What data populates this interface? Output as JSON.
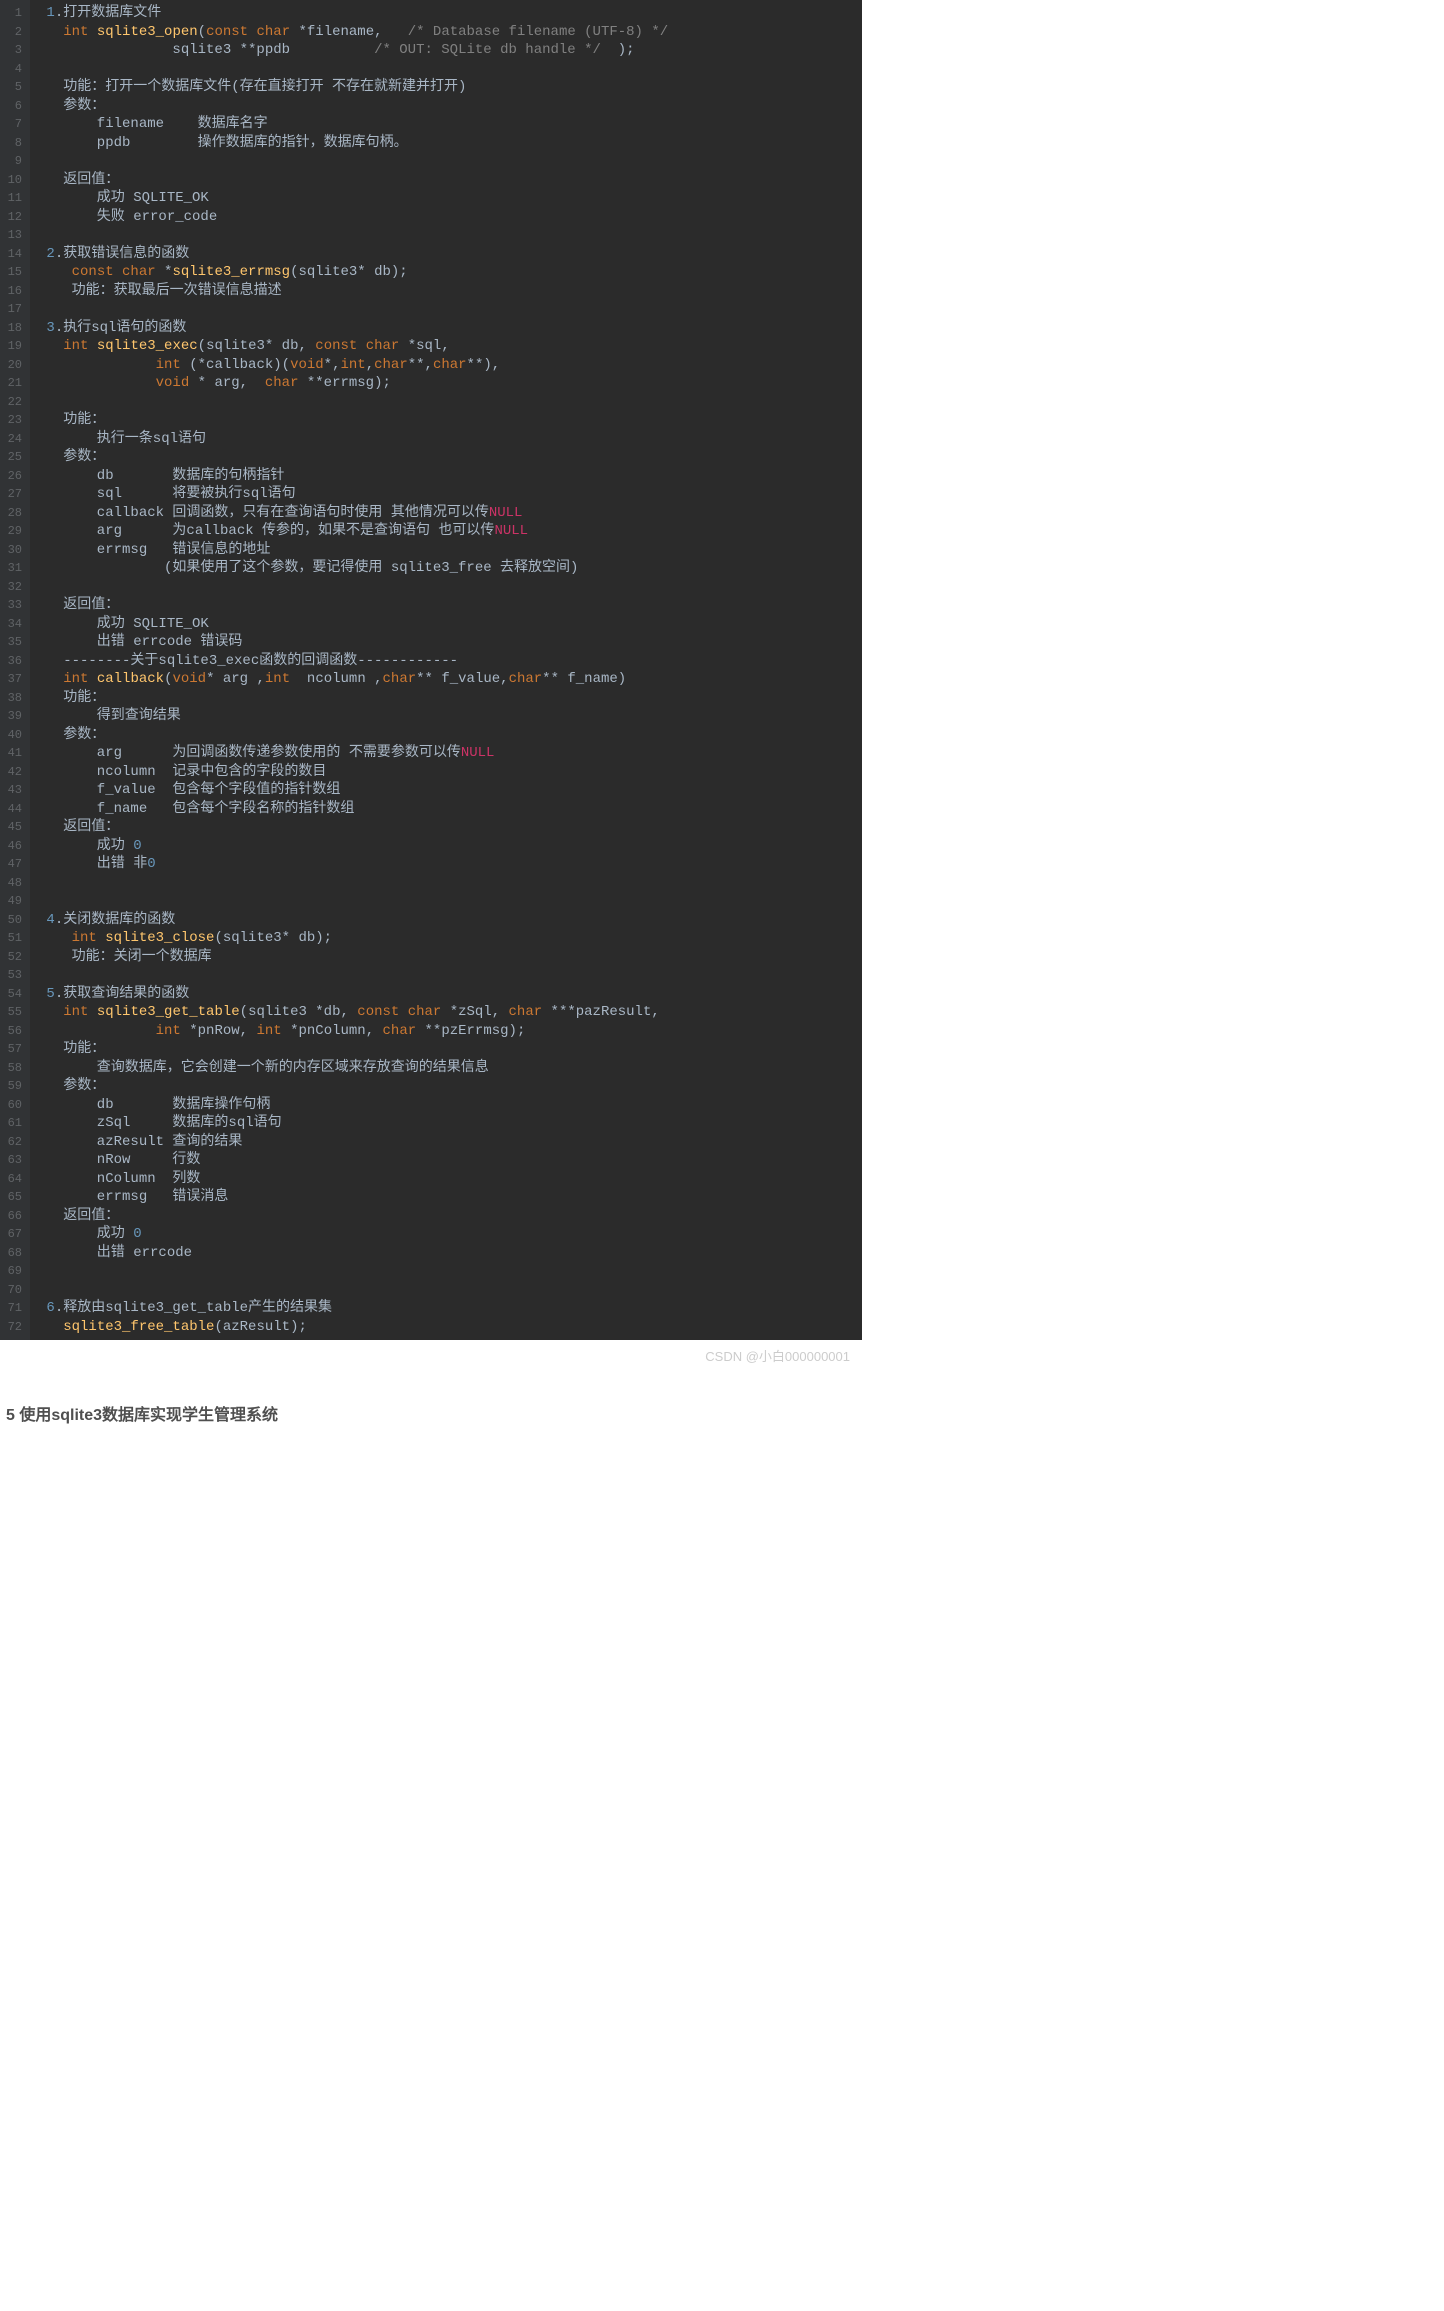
{
  "lines": [
    {
      "n": "1",
      "segs": [
        {
          "t": " "
        },
        {
          "t": "1",
          "c": "num"
        },
        {
          "t": ".打开数据库文件"
        }
      ]
    },
    {
      "n": "2",
      "segs": [
        {
          "t": "   "
        },
        {
          "t": "int",
          "c": "kw"
        },
        {
          "t": " "
        },
        {
          "t": "sqlite3_open",
          "c": "fn"
        },
        {
          "t": "("
        },
        {
          "t": "const char",
          "c": "kw"
        },
        {
          "t": " *filename,   "
        },
        {
          "t": "/* Database filename (UTF-8) */",
          "c": "cmt"
        }
      ]
    },
    {
      "n": "3",
      "segs": [
        {
          "t": "                sqlite3 **ppdb          "
        },
        {
          "t": "/* OUT: SQLite db handle */",
          "c": "cmt"
        },
        {
          "t": "  );"
        }
      ]
    },
    {
      "n": "4",
      "segs": [
        {
          "t": ""
        }
      ]
    },
    {
      "n": "5",
      "segs": [
        {
          "t": "   功能：打开一个数据库文件(存在直接打开 不存在就新建并打开)"
        }
      ]
    },
    {
      "n": "6",
      "segs": [
        {
          "t": "   参数："
        }
      ]
    },
    {
      "n": "7",
      "segs": [
        {
          "t": "       filename    数据库名字"
        }
      ]
    },
    {
      "n": "8",
      "segs": [
        {
          "t": "       ppdb        操作数据库的指针，数据库句柄。"
        }
      ]
    },
    {
      "n": "9",
      "segs": [
        {
          "t": ""
        }
      ]
    },
    {
      "n": "10",
      "segs": [
        {
          "t": "   返回值："
        }
      ]
    },
    {
      "n": "11",
      "segs": [
        {
          "t": "       成功 SQLITE_OK"
        }
      ]
    },
    {
      "n": "12",
      "segs": [
        {
          "t": "       失败 error_code"
        }
      ]
    },
    {
      "n": "13",
      "segs": [
        {
          "t": ""
        }
      ]
    },
    {
      "n": "14",
      "segs": [
        {
          "t": " "
        },
        {
          "t": "2",
          "c": "num"
        },
        {
          "t": ".获取错误信息的函数"
        }
      ]
    },
    {
      "n": "15",
      "segs": [
        {
          "t": "    "
        },
        {
          "t": "const char",
          "c": "kw"
        },
        {
          "t": " *"
        },
        {
          "t": "sqlite3_errmsg",
          "c": "fn"
        },
        {
          "t": "(sqlite3* db);"
        }
      ]
    },
    {
      "n": "16",
      "segs": [
        {
          "t": "    功能：获取最后一次错误信息描述"
        }
      ]
    },
    {
      "n": "17",
      "segs": [
        {
          "t": ""
        }
      ]
    },
    {
      "n": "18",
      "segs": [
        {
          "t": " "
        },
        {
          "t": "3",
          "c": "num"
        },
        {
          "t": ".执行sql语句的函数"
        }
      ]
    },
    {
      "n": "19",
      "segs": [
        {
          "t": "   "
        },
        {
          "t": "int",
          "c": "kw"
        },
        {
          "t": " "
        },
        {
          "t": "sqlite3_exec",
          "c": "fn"
        },
        {
          "t": "(sqlite3* db, "
        },
        {
          "t": "const char",
          "c": "kw"
        },
        {
          "t": " *sql,"
        }
      ]
    },
    {
      "n": "20",
      "segs": [
        {
          "t": "              "
        },
        {
          "t": "int",
          "c": "kw"
        },
        {
          "t": " (*callback)("
        },
        {
          "t": "void",
          "c": "kw"
        },
        {
          "t": "*,"
        },
        {
          "t": "int",
          "c": "kw"
        },
        {
          "t": ","
        },
        {
          "t": "char",
          "c": "kw"
        },
        {
          "t": "**,"
        },
        {
          "t": "char",
          "c": "kw"
        },
        {
          "t": "**),"
        }
      ]
    },
    {
      "n": "21",
      "segs": [
        {
          "t": "              "
        },
        {
          "t": "void",
          "c": "kw"
        },
        {
          "t": " * arg,  "
        },
        {
          "t": "char",
          "c": "kw"
        },
        {
          "t": " **errmsg);"
        }
      ]
    },
    {
      "n": "22",
      "segs": [
        {
          "t": ""
        }
      ]
    },
    {
      "n": "23",
      "segs": [
        {
          "t": "   功能："
        }
      ]
    },
    {
      "n": "24",
      "segs": [
        {
          "t": "       执行一条sql语句"
        }
      ]
    },
    {
      "n": "25",
      "segs": [
        {
          "t": "   参数："
        }
      ]
    },
    {
      "n": "26",
      "segs": [
        {
          "t": "       db       数据库的句柄指针"
        }
      ]
    },
    {
      "n": "27",
      "segs": [
        {
          "t": "       sql      将要被执行sql语句"
        }
      ]
    },
    {
      "n": "28",
      "segs": [
        {
          "t": "       callback 回调函数，只有在查询语句时使用 其他情况可以传"
        },
        {
          "t": "NULL",
          "c": "nul"
        }
      ]
    },
    {
      "n": "29",
      "segs": [
        {
          "t": "       arg      为callback 传参的，如果不是查询语句 也可以传"
        },
        {
          "t": "NULL",
          "c": "nul"
        }
      ]
    },
    {
      "n": "30",
      "segs": [
        {
          "t": "       errmsg   错误信息的地址"
        }
      ]
    },
    {
      "n": "31",
      "segs": [
        {
          "t": "               (如果使用了这个参数，要记得使用 sqlite3_free 去释放空间)"
        }
      ]
    },
    {
      "n": "32",
      "segs": [
        {
          "t": ""
        }
      ]
    },
    {
      "n": "33",
      "segs": [
        {
          "t": "   返回值："
        }
      ]
    },
    {
      "n": "34",
      "segs": [
        {
          "t": "       成功 SQLITE_OK"
        }
      ]
    },
    {
      "n": "35",
      "segs": [
        {
          "t": "       出错 errcode 错误码"
        }
      ]
    },
    {
      "n": "36",
      "segs": [
        {
          "t": "   --------关于sqlite3_exec函数的回调函数------------"
        }
      ]
    },
    {
      "n": "37",
      "segs": [
        {
          "t": "   "
        },
        {
          "t": "int",
          "c": "kw"
        },
        {
          "t": " "
        },
        {
          "t": "callback",
          "c": "fn"
        },
        {
          "t": "("
        },
        {
          "t": "void",
          "c": "kw"
        },
        {
          "t": "* arg ,"
        },
        {
          "t": "int",
          "c": "kw"
        },
        {
          "t": "  ncolumn ,"
        },
        {
          "t": "char",
          "c": "kw"
        },
        {
          "t": "** f_value,"
        },
        {
          "t": "char",
          "c": "kw"
        },
        {
          "t": "** f_name)"
        }
      ]
    },
    {
      "n": "38",
      "segs": [
        {
          "t": "   功能："
        }
      ]
    },
    {
      "n": "39",
      "segs": [
        {
          "t": "       得到查询结果"
        }
      ]
    },
    {
      "n": "40",
      "segs": [
        {
          "t": "   参数："
        }
      ]
    },
    {
      "n": "41",
      "segs": [
        {
          "t": "       arg      为回调函数传递参数使用的 不需要参数可以传"
        },
        {
          "t": "NULL",
          "c": "nul"
        }
      ]
    },
    {
      "n": "42",
      "segs": [
        {
          "t": "       ncolumn  记录中包含的字段的数目"
        }
      ]
    },
    {
      "n": "43",
      "segs": [
        {
          "t": "       f_value  包含每个字段值的指针数组"
        }
      ]
    },
    {
      "n": "44",
      "segs": [
        {
          "t": "       f_name   包含每个字段名称的指针数组"
        }
      ]
    },
    {
      "n": "45",
      "segs": [
        {
          "t": "   返回值："
        }
      ]
    },
    {
      "n": "46",
      "segs": [
        {
          "t": "       成功 "
        },
        {
          "t": "0",
          "c": "num"
        }
      ]
    },
    {
      "n": "47",
      "segs": [
        {
          "t": "       出错 非"
        },
        {
          "t": "0",
          "c": "num"
        }
      ]
    },
    {
      "n": "48",
      "segs": [
        {
          "t": ""
        }
      ]
    },
    {
      "n": "49",
      "segs": [
        {
          "t": ""
        }
      ]
    },
    {
      "n": "50",
      "segs": [
        {
          "t": " "
        },
        {
          "t": "4",
          "c": "num"
        },
        {
          "t": ".关闭数据库的函数"
        }
      ]
    },
    {
      "n": "51",
      "segs": [
        {
          "t": "    "
        },
        {
          "t": "int",
          "c": "kw"
        },
        {
          "t": " "
        },
        {
          "t": "sqlite3_close",
          "c": "fn"
        },
        {
          "t": "(sqlite3* db);"
        }
      ]
    },
    {
      "n": "52",
      "segs": [
        {
          "t": "    功能：关闭一个数据库"
        }
      ]
    },
    {
      "n": "53",
      "segs": [
        {
          "t": ""
        }
      ]
    },
    {
      "n": "54",
      "segs": [
        {
          "t": " "
        },
        {
          "t": "5",
          "c": "num"
        },
        {
          "t": ".获取查询结果的函数"
        }
      ]
    },
    {
      "n": "55",
      "segs": [
        {
          "t": "   "
        },
        {
          "t": "int",
          "c": "kw"
        },
        {
          "t": " "
        },
        {
          "t": "sqlite3_get_table",
          "c": "fn"
        },
        {
          "t": "(sqlite3 *db, "
        },
        {
          "t": "const char",
          "c": "kw"
        },
        {
          "t": " *zSql, "
        },
        {
          "t": "char",
          "c": "kw"
        },
        {
          "t": " ***pazResult,"
        }
      ]
    },
    {
      "n": "56",
      "segs": [
        {
          "t": "              "
        },
        {
          "t": "int",
          "c": "kw"
        },
        {
          "t": " *pnRow, "
        },
        {
          "t": "int",
          "c": "kw"
        },
        {
          "t": " *pnColumn, "
        },
        {
          "t": "char",
          "c": "kw"
        },
        {
          "t": " **pzErrmsg);"
        }
      ]
    },
    {
      "n": "57",
      "segs": [
        {
          "t": "   功能："
        }
      ]
    },
    {
      "n": "58",
      "segs": [
        {
          "t": "       查询数据库，它会创建一个新的内存区域来存放查询的结果信息"
        }
      ]
    },
    {
      "n": "59",
      "segs": [
        {
          "t": "   参数："
        }
      ]
    },
    {
      "n": "60",
      "segs": [
        {
          "t": "       db       数据库操作句柄"
        }
      ]
    },
    {
      "n": "61",
      "segs": [
        {
          "t": "       zSql     数据库的sql语句"
        }
      ]
    },
    {
      "n": "62",
      "segs": [
        {
          "t": "       azResult 查询的结果"
        }
      ]
    },
    {
      "n": "63",
      "segs": [
        {
          "t": "       nRow     行数"
        }
      ]
    },
    {
      "n": "64",
      "segs": [
        {
          "t": "       nColumn  列数"
        }
      ]
    },
    {
      "n": "65",
      "segs": [
        {
          "t": "       errmsg   错误消息"
        }
      ]
    },
    {
      "n": "66",
      "segs": [
        {
          "t": "   返回值："
        }
      ]
    },
    {
      "n": "67",
      "segs": [
        {
          "t": "       成功 "
        },
        {
          "t": "0",
          "c": "num"
        }
      ]
    },
    {
      "n": "68",
      "segs": [
        {
          "t": "       出错 errcode"
        }
      ]
    },
    {
      "n": "69",
      "segs": [
        {
          "t": ""
        }
      ]
    },
    {
      "n": "70",
      "segs": [
        {
          "t": ""
        }
      ]
    },
    {
      "n": "71",
      "segs": [
        {
          "t": " "
        },
        {
          "t": "6",
          "c": "num"
        },
        {
          "t": ".释放由sqlite3_get_table产生的结果集"
        }
      ]
    },
    {
      "n": "72",
      "segs": [
        {
          "t": "   "
        },
        {
          "t": "sqlite3_free_table",
          "c": "fn"
        },
        {
          "t": "(azResult);"
        }
      ]
    }
  ],
  "watermark": "CSDN @小白000000001",
  "heading": "5 使用sqlite3数据库实现学生管理系统"
}
